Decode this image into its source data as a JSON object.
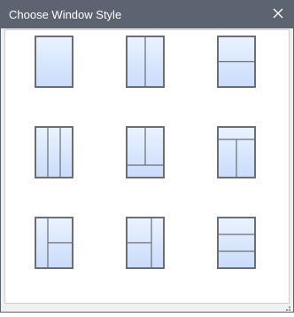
{
  "window": {
    "title": "Choose Window Style",
    "close_icon": "close-icon",
    "colors": {
      "titlebar": "#5b6470",
      "frame": "#6d6e72",
      "glass_top": "#eaf3ff",
      "glass_bottom": "#c9dcfb"
    }
  },
  "styles": [
    {
      "name": "single-pane"
    },
    {
      "name": "two-vertical-panes"
    },
    {
      "name": "two-horizontal-panes"
    },
    {
      "name": "three-vertical-panes"
    },
    {
      "name": "top-split-over-wide-bottom"
    },
    {
      "name": "wide-top-over-split-bottom"
    },
    {
      "name": "left-tall-right-split"
    },
    {
      "name": "left-split-right-tall"
    },
    {
      "name": "three-horizontal-panes"
    }
  ],
  "resize_grip_icon": "resize-grip-icon"
}
